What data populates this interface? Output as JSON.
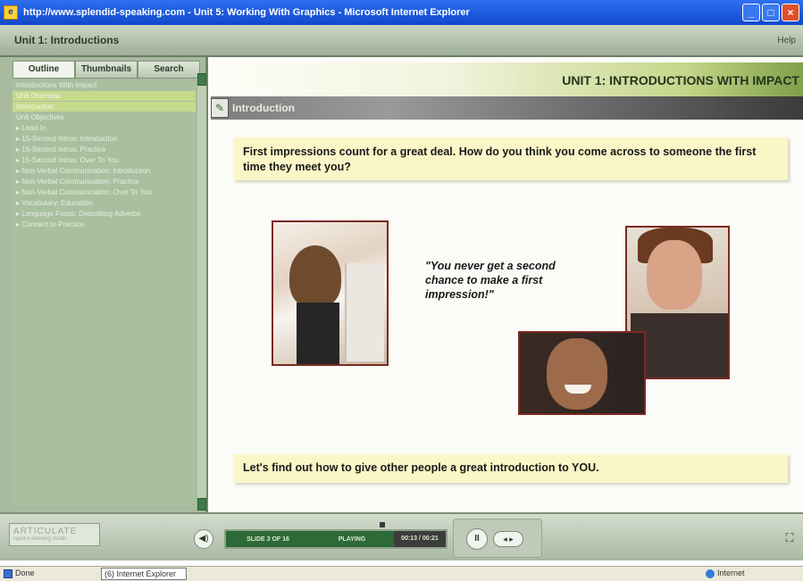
{
  "window": {
    "title": "http://www.splendid-speaking.com - Unit 5: Working With Graphics - Microsoft Internet Explorer",
    "icon": "ie-icon"
  },
  "header": {
    "unit_title": "Unit 1: Introductions",
    "help": "Help"
  },
  "sidebar": {
    "tabs": [
      {
        "label": "Outline",
        "active": true
      },
      {
        "label": "Thumbnails",
        "active": false
      },
      {
        "label": "Search",
        "active": false
      }
    ],
    "items": [
      {
        "label": "Introductions With Impact",
        "highlight": false
      },
      {
        "label": "Unit Overview",
        "highlight": true
      },
      {
        "label": "Introduction",
        "highlight": true
      },
      {
        "label": "Unit Objectives",
        "highlight": false
      },
      {
        "label": "▸ Lead-In",
        "highlight": false
      },
      {
        "label": "▸ 15-Second Intros: Introduction",
        "highlight": false
      },
      {
        "label": "▸ 15-Second Intros: Practice",
        "highlight": false
      },
      {
        "label": "▸ 15-Second Intros: Over To You",
        "highlight": false
      },
      {
        "label": "▸ Non-Verbal Communication: Introduction",
        "highlight": false
      },
      {
        "label": "▸ Non-Verbal Communication: Practice",
        "highlight": false
      },
      {
        "label": "▸ Non-Verbal Communication: Over To You",
        "highlight": false
      },
      {
        "label": "▸ Vocabulary: Education",
        "highlight": false
      },
      {
        "label": "▸ Language Focus: Describing Adverbs",
        "highlight": false
      },
      {
        "label": "▸ Connect to Practice",
        "highlight": false
      }
    ]
  },
  "main": {
    "unit_heading": "UNIT 1: INTRODUCTIONS WITH IMPACT",
    "section_title": "Introduction",
    "prompt": "First impressions count for a great deal. How do you think you come across to someone the first time they meet you?",
    "quote": "\"You never get a second chance to make a first impression!\"",
    "closing": "Let's find out how to give other people a great introduction to YOU."
  },
  "player": {
    "logo": "ARTICULATE",
    "logo_sub": "rapid e-learning studio",
    "slide_label": "SLIDE 3 OF 16",
    "status_label": "PLAYING",
    "time_label": "00:13 / 00:21",
    "pause_symbol": "II",
    "seek_symbol": "◂ ▸",
    "volume_symbol": "◀)",
    "fullscreen_symbol": "⛶"
  },
  "statusbar": {
    "done": "Done",
    "task": "(6) Internet Explorer",
    "zone": "Internet"
  },
  "colors": {
    "title_bar": "#1e56d8",
    "sidebar_bg": "#a8bb9e",
    "highlight": "#c6da8c",
    "prompt_bg": "#fbf6c8",
    "progress": "#2c6a37"
  }
}
